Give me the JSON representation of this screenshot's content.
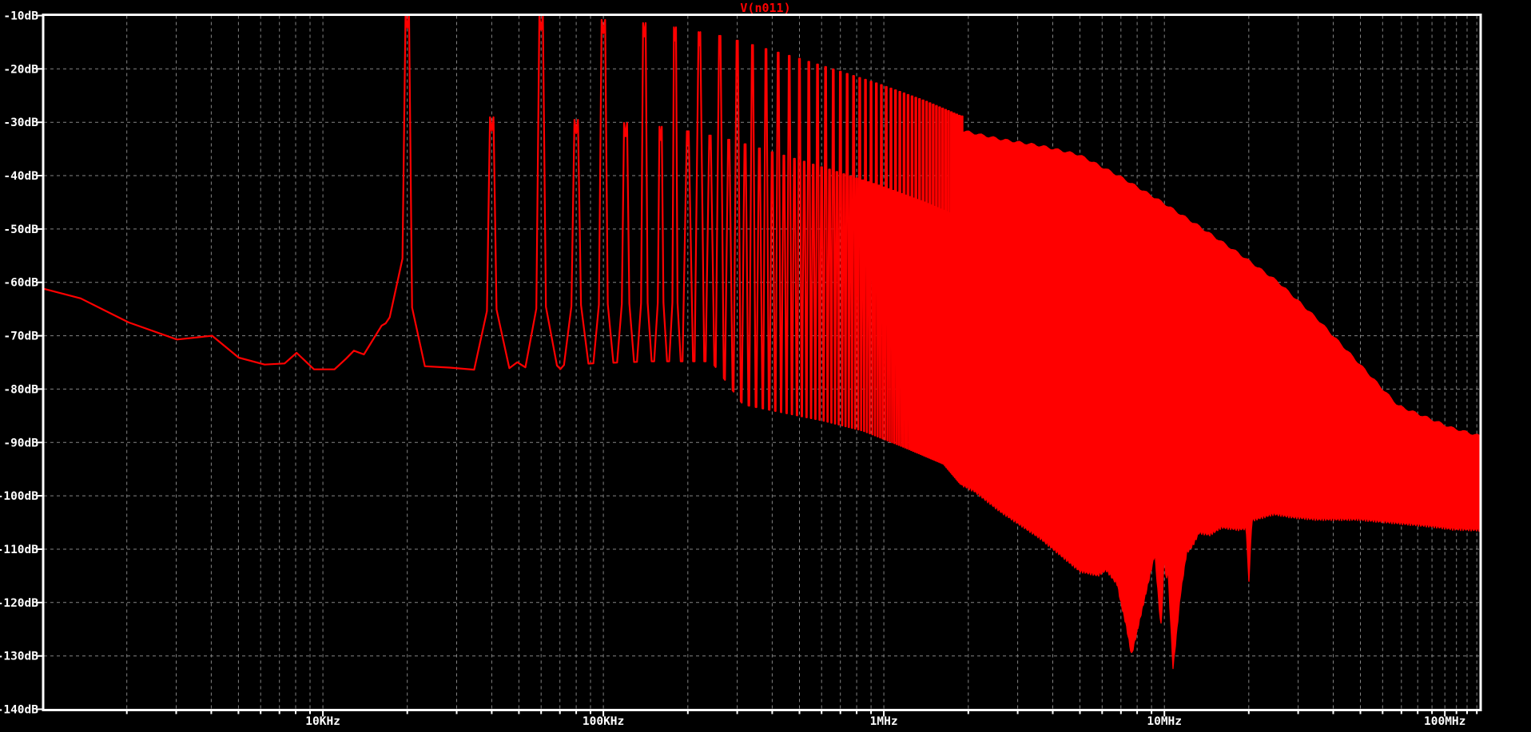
{
  "window": {
    "kind": "waveform-viewer-pane"
  },
  "colors": {
    "background": "#000000",
    "trace": "#ff0000",
    "grid": "#848484",
    "axis": "#ffffff",
    "title": "#ff0000"
  },
  "chart_data": {
    "type": "line",
    "subtype": "fft-spectrum",
    "title": "V(n011)",
    "legend_position": "top-center",
    "grid": "dashed",
    "x_axis": {
      "scale": "log",
      "unit": "Hz",
      "min_hz": 1013,
      "max_hz": 133300000,
      "labels": [
        {
          "hz": 10000,
          "label": "10KHz"
        },
        {
          "hz": 100000,
          "label": "100KHz"
        },
        {
          "hz": 1000000,
          "label": "1MHz"
        },
        {
          "hz": 10000000,
          "label": "10MHz"
        },
        {
          "hz": 100000000,
          "label": "100MHz"
        }
      ]
    },
    "y_axis": {
      "unit": "dB",
      "max_db": -10,
      "min_db": -140,
      "step_db": 10,
      "labels": [
        {
          "db": -10,
          "label": "-10dB"
        },
        {
          "db": -20,
          "label": "-20dB"
        },
        {
          "db": -30,
          "label": "-30dB"
        },
        {
          "db": -40,
          "label": "-40dB"
        },
        {
          "db": -50,
          "label": "-50dB"
        },
        {
          "db": -60,
          "label": "-60dB"
        },
        {
          "db": -70,
          "label": "-70dB"
        },
        {
          "db": -80,
          "label": "-80dB"
        },
        {
          "db": -90,
          "label": "-90dB"
        },
        {
          "db": -100,
          "label": "-100dB"
        },
        {
          "db": -110,
          "label": "-110dB"
        },
        {
          "db": -120,
          "label": "-120dB"
        },
        {
          "db": -130,
          "label": "-130dB"
        },
        {
          "db": -140,
          "label": "-140dB"
        }
      ]
    },
    "series": {
      "name": "V(n011)",
      "fundamental_hz": 20000,
      "merge_freq_hz": 1900000,
      "even_harmonic_offset_db": -19,
      "odd_harmonic_envelope_db": [
        [
          20000,
          -12.3
        ],
        [
          60000,
          -12.7
        ],
        [
          100000,
          -13.3
        ],
        [
          140000,
          -13.9
        ],
        [
          180000,
          -14.7
        ],
        [
          220000,
          -15.6
        ],
        [
          260000,
          -16.3
        ],
        [
          330000,
          -17.8
        ],
        [
          500000,
          -20.6
        ],
        [
          700000,
          -23.0
        ],
        [
          966000,
          -25.4
        ],
        [
          1400000,
          -28.5
        ],
        [
          1870000,
          -31.3
        ],
        [
          2600000,
          -33.0
        ],
        [
          3600000,
          -34.2
        ],
        [
          4950000,
          -35.9
        ],
        [
          6900000,
          -39.9
        ],
        [
          9550000,
          -44.4
        ],
        [
          13200000,
          -49.2
        ],
        [
          18400000,
          -54.4
        ],
        [
          25500000,
          -59.8
        ],
        [
          35400000,
          -66.9
        ],
        [
          49000000,
          -74.8
        ],
        [
          68000000,
          -82.9
        ],
        [
          106000000,
          -87.1
        ],
        [
          133000000,
          -88.6
        ]
      ],
      "floor_envelope_db": [
        [
          1013,
          -61.2
        ],
        [
          1370,
          -63.0
        ],
        [
          2030,
          -67.5
        ],
        [
          3020,
          -70.7
        ],
        [
          4030,
          -70.0
        ],
        [
          5010,
          -74.1
        ],
        [
          6200,
          -75.4
        ],
        [
          7300,
          -75.2
        ],
        [
          8060,
          -73.2
        ],
        [
          9300,
          -76.3
        ],
        [
          11000,
          -76.3
        ],
        [
          12100,
          -74.3
        ],
        [
          12900,
          -72.8
        ],
        [
          14000,
          -73.5
        ],
        [
          16200,
          -68.1
        ],
        [
          17500,
          -66.3
        ],
        [
          23000,
          -75.7
        ],
        [
          30000,
          -76.5
        ],
        [
          50000,
          -76.0
        ],
        [
          90000,
          -75.2
        ],
        [
          150000,
          -74.8
        ],
        [
          243000,
          -74.8
        ],
        [
          315000,
          -82.9
        ],
        [
          438000,
          -84.4
        ],
        [
          606000,
          -85.9
        ],
        [
          843000,
          -87.8
        ],
        [
          1170000,
          -90.8
        ],
        [
          1630000,
          -94.0
        ],
        [
          1870000,
          -97.7
        ],
        [
          2100000,
          -99.0
        ],
        [
          2600000,
          -102.8
        ],
        [
          3600000,
          -107.8
        ],
        [
          5000000,
          -114.0
        ],
        [
          5800000,
          -114.8
        ],
        [
          6200000,
          -113.8
        ],
        [
          6800000,
          -116.5
        ],
        [
          7000000,
          -120.0
        ],
        [
          7300000,
          -124.0
        ],
        [
          7640000,
          -129.8
        ],
        [
          9250000,
          -110.8
        ],
        [
          9720000,
          -124.6
        ],
        [
          9850000,
          -119.0
        ],
        [
          9980000,
          -110.6
        ],
        [
          10150000,
          -116.0
        ],
        [
          10300000,
          -113.6
        ],
        [
          10740000,
          -132.3
        ],
        [
          11400000,
          -118.5
        ],
        [
          12000000,
          -110.6
        ],
        [
          12600000,
          -109.3
        ],
        [
          13300000,
          -106.8
        ],
        [
          14500000,
          -107.2
        ],
        [
          16000000,
          -105.8
        ],
        [
          18400000,
          -106.2
        ],
        [
          19600000,
          -106.0
        ],
        [
          20000000,
          -116.3
        ],
        [
          20500000,
          -104.5
        ],
        [
          24600000,
          -103.3
        ],
        [
          28800000,
          -103.9
        ],
        [
          35000000,
          -104.3
        ],
        [
          49000000,
          -104.3
        ],
        [
          68000000,
          -105.0
        ],
        [
          90000000,
          -105.6
        ],
        [
          106000000,
          -106.1
        ],
        [
          133000000,
          -106.3
        ]
      ]
    }
  }
}
